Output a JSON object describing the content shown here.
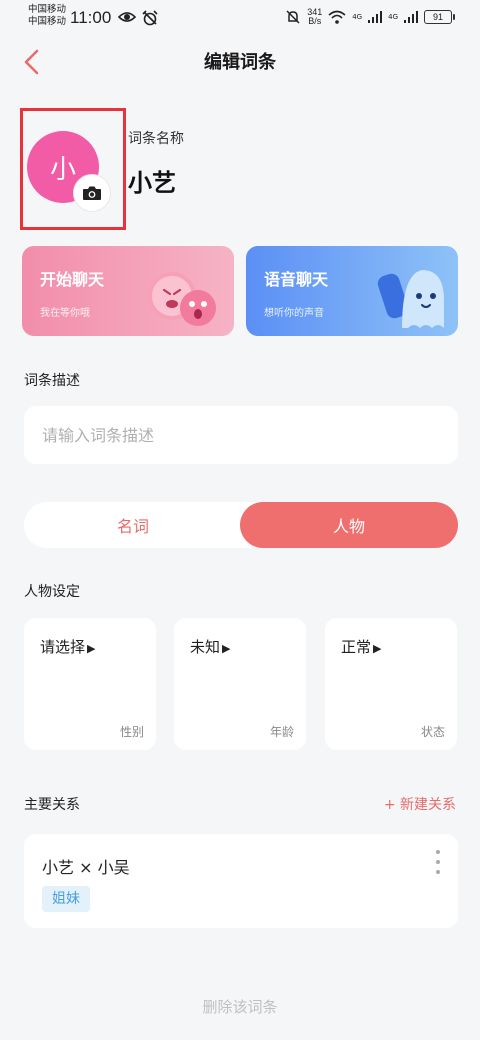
{
  "status_bar": {
    "carrier1": "中国移动",
    "carrier2": "中国移动",
    "time": "11:00",
    "net_speed_value": "341",
    "net_speed_unit": "B/s",
    "signal1_label": "4G",
    "signal2_label": "4G",
    "battery": "91"
  },
  "header": {
    "title": "编辑词条"
  },
  "entry": {
    "avatar_letter": "小",
    "name_label": "词条名称",
    "name_value": "小艺"
  },
  "cards": {
    "chat_title": "开始聊天",
    "chat_sub": "我在等你哦",
    "voice_title": "语音聊天",
    "voice_sub": "想听你的声音"
  },
  "description": {
    "label": "词条描述",
    "placeholder": "请输入词条描述",
    "value": ""
  },
  "type_toggle": {
    "noun": "名词",
    "person": "人物",
    "selected": "人物"
  },
  "person_settings": {
    "label": "人物设定",
    "items": [
      {
        "value": "请选择",
        "label": "性别"
      },
      {
        "value": "未知",
        "label": "年龄"
      },
      {
        "value": "正常",
        "label": "状态"
      }
    ]
  },
  "relations": {
    "label": "主要关系",
    "new_label": "+ 新建关系",
    "items": [
      {
        "names": "小艺 × 小吴",
        "tag": "姐妹"
      }
    ]
  },
  "delete_label": "删除该词条",
  "colors": {
    "accent": "#ef6f6f",
    "avatar": "#f25ba6",
    "highlight_box": "#e8333b",
    "chat_card": "#f28dab",
    "voice_card": "#5b8ff5",
    "tag_bg": "#e3f1fb",
    "tag_text": "#4a9fdf"
  }
}
